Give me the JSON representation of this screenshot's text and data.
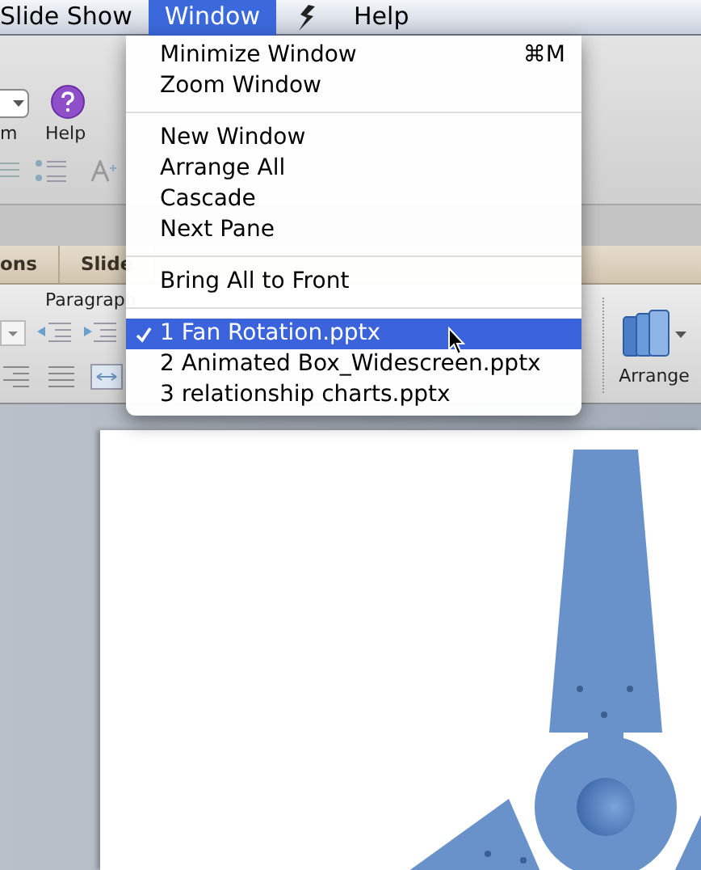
{
  "menu_bar": [
    {
      "kind": "text",
      "label": "Slide Show",
      "selected": false
    },
    {
      "kind": "text",
      "label": "Window",
      "selected": true
    },
    {
      "kind": "icon",
      "selected": false
    },
    {
      "kind": "text",
      "label": "Help",
      "selected": false
    }
  ],
  "ribbon": {
    "group_label": "m",
    "help_button": "Help",
    "tabs": [
      {
        "label": "ons",
        "selected": false
      },
      {
        "label": "Slide",
        "selected": false
      }
    ],
    "paragraph_label": "Paragraph",
    "arrange_button": "Arrange"
  },
  "window_menu": {
    "groups": [
      [
        {
          "label": "Minimize Window",
          "shortcut": "⌘M",
          "checked": false,
          "selected": false
        },
        {
          "label": "Zoom Window",
          "checked": false,
          "selected": false
        }
      ],
      [
        {
          "label": "New Window",
          "checked": false,
          "selected": false
        },
        {
          "label": "Arrange All",
          "checked": false,
          "selected": false
        },
        {
          "label": "Cascade",
          "checked": false,
          "selected": false
        },
        {
          "label": "Next Pane",
          "checked": false,
          "selected": false
        }
      ],
      [
        {
          "label": "Bring All to Front",
          "checked": false,
          "selected": false
        }
      ],
      [
        {
          "label": "1 Fan Rotation.pptx",
          "checked": true,
          "selected": true
        },
        {
          "label": "2 Animated Box_Widescreen.pptx",
          "checked": false,
          "selected": false
        },
        {
          "label": "3 relationship charts.pptx",
          "checked": false,
          "selected": false
        }
      ]
    ]
  }
}
